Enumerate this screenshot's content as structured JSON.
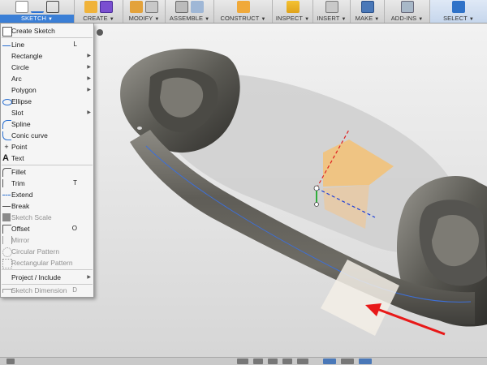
{
  "toolbar": {
    "groups": [
      {
        "label": "SKETCH",
        "active": true
      },
      {
        "label": "CREATE",
        "active": false
      },
      {
        "label": "MODIFY",
        "active": false
      },
      {
        "label": "ASSEMBLE",
        "active": false
      },
      {
        "label": "CONSTRUCT",
        "active": false
      },
      {
        "label": "INSPECT",
        "active": false
      },
      {
        "label": "INSERT",
        "active": false
      },
      {
        "label": "MAKE",
        "active": false
      },
      {
        "label": "ADD-INS",
        "active": false
      },
      {
        "label": "SELECT",
        "active": false
      }
    ]
  },
  "sketch_menu": {
    "items": [
      {
        "label": "Create Sketch",
        "shortcut": "",
        "submenu": false,
        "disabled": false,
        "icon": "create-sketch-icon"
      },
      {
        "label": "Line",
        "shortcut": "L",
        "submenu": false,
        "disabled": false,
        "icon": "line-icon"
      },
      {
        "label": "Rectangle",
        "shortcut": "",
        "submenu": true,
        "disabled": false,
        "icon": ""
      },
      {
        "label": "Circle",
        "shortcut": "",
        "submenu": true,
        "disabled": false,
        "icon": ""
      },
      {
        "label": "Arc",
        "shortcut": "",
        "submenu": true,
        "disabled": false,
        "icon": ""
      },
      {
        "label": "Polygon",
        "shortcut": "",
        "submenu": true,
        "disabled": false,
        "icon": ""
      },
      {
        "label": "Ellipse",
        "shortcut": "",
        "submenu": false,
        "disabled": false,
        "icon": "ellipse-icon"
      },
      {
        "label": "Slot",
        "shortcut": "",
        "submenu": true,
        "disabled": false,
        "icon": ""
      },
      {
        "label": "Spline",
        "shortcut": "",
        "submenu": false,
        "disabled": false,
        "icon": "spline-icon"
      },
      {
        "label": "Conic curve",
        "shortcut": "",
        "submenu": false,
        "disabled": false,
        "icon": "conic-curve-icon"
      },
      {
        "label": "Point",
        "shortcut": "",
        "submenu": false,
        "disabled": false,
        "icon": "point-icon"
      },
      {
        "label": "Text",
        "shortcut": "",
        "submenu": false,
        "disabled": false,
        "icon": "text-icon"
      },
      {
        "label": "Fillet",
        "shortcut": "",
        "submenu": false,
        "disabled": false,
        "icon": "fillet-icon"
      },
      {
        "label": "Trim",
        "shortcut": "T",
        "submenu": false,
        "disabled": false,
        "icon": "trim-icon"
      },
      {
        "label": "Extend",
        "shortcut": "",
        "submenu": false,
        "disabled": false,
        "icon": "extend-icon"
      },
      {
        "label": "Break",
        "shortcut": "",
        "submenu": false,
        "disabled": false,
        "icon": "break-icon"
      },
      {
        "label": "Sketch Scale",
        "shortcut": "",
        "submenu": false,
        "disabled": true,
        "icon": "sketch-scale-icon"
      },
      {
        "label": "Offset",
        "shortcut": "O",
        "submenu": false,
        "disabled": false,
        "icon": "offset-icon"
      },
      {
        "label": "Mirror",
        "shortcut": "",
        "submenu": false,
        "disabled": true,
        "icon": "mirror-icon"
      },
      {
        "label": "Circular Pattern",
        "shortcut": "",
        "submenu": false,
        "disabled": true,
        "icon": "circular-pattern-icon"
      },
      {
        "label": "Rectangular Pattern",
        "shortcut": "",
        "submenu": false,
        "disabled": true,
        "icon": "rectangular-pattern-icon"
      },
      {
        "label": "Project / Include",
        "shortcut": "",
        "submenu": true,
        "disabled": false,
        "icon": ""
      },
      {
        "label": "Sketch Dimension",
        "shortcut": "D",
        "submenu": false,
        "disabled": true,
        "icon": "sketch-dimension-icon"
      }
    ]
  },
  "colors": {
    "accent": "#3b7fd6",
    "sketch_plane": "#f2c27a",
    "axis_red": "#e02020",
    "axis_green": "#2fae3a",
    "axis_blue": "#1f3fd6",
    "arrow": "#e81818",
    "headphone_metal": "#6c6a63"
  }
}
